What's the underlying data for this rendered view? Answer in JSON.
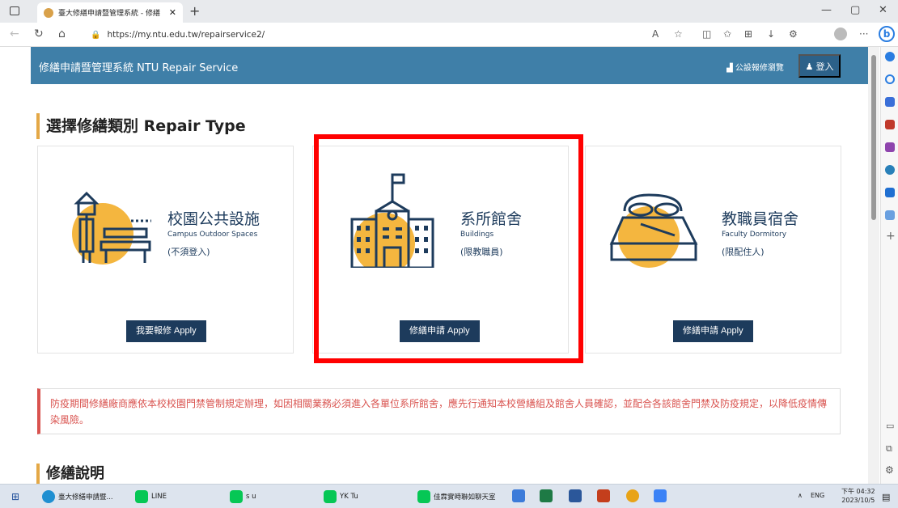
{
  "browser": {
    "tab_title": "臺大修繕申請暨管理系統 - 修繕",
    "url": "https://my.ntu.edu.tw/repairservice2/"
  },
  "header": {
    "brand": "修繕申請暨管理系統 NTU Repair Service",
    "public_view": "公設報修瀏覽",
    "login": "登入"
  },
  "section": {
    "title": "選擇修繕類別 Repair Type"
  },
  "cards": [
    {
      "title": "校園公共設施",
      "subtitle": "Campus Outdoor Spaces",
      "note": "(不須登入)",
      "button": "我要報修 Apply"
    },
    {
      "title": "系所館舍",
      "subtitle": "Buildings",
      "note": "(限教職員)",
      "button": "修繕申請 Apply"
    },
    {
      "title": "教職員宿舍",
      "subtitle": "Faculty Dormitory",
      "note": "(限配住人)",
      "button": "修繕申請 Apply"
    }
  ],
  "alert": "防疫期間修繕廠商應依本校校園門禁管制規定辦理，如因相關業務必須進入各單位系所館舍，應先行通知本校營繕組及館舍人員確認，並配合各該館舍門禁及防疫規定，以降低疫情傳染風險。",
  "section2": {
    "title": "修繕說明"
  },
  "taskbar": {
    "items": [
      {
        "label": "臺大修繕申請暨..."
      },
      {
        "label": "LINE"
      },
      {
        "label": "s u"
      },
      {
        "label": "YK Tu"
      },
      {
        "label": "佳霖實時聯如聊天室"
      }
    ],
    "lang": "ENG",
    "time": "下午 04:32",
    "date": "2023/10/5"
  },
  "colors": {
    "header_bg": "#3f7fa8",
    "accent": "#e4a846",
    "navy": "#1d3b5c",
    "alert": "#d9534f",
    "highlight": "#ff0000"
  }
}
